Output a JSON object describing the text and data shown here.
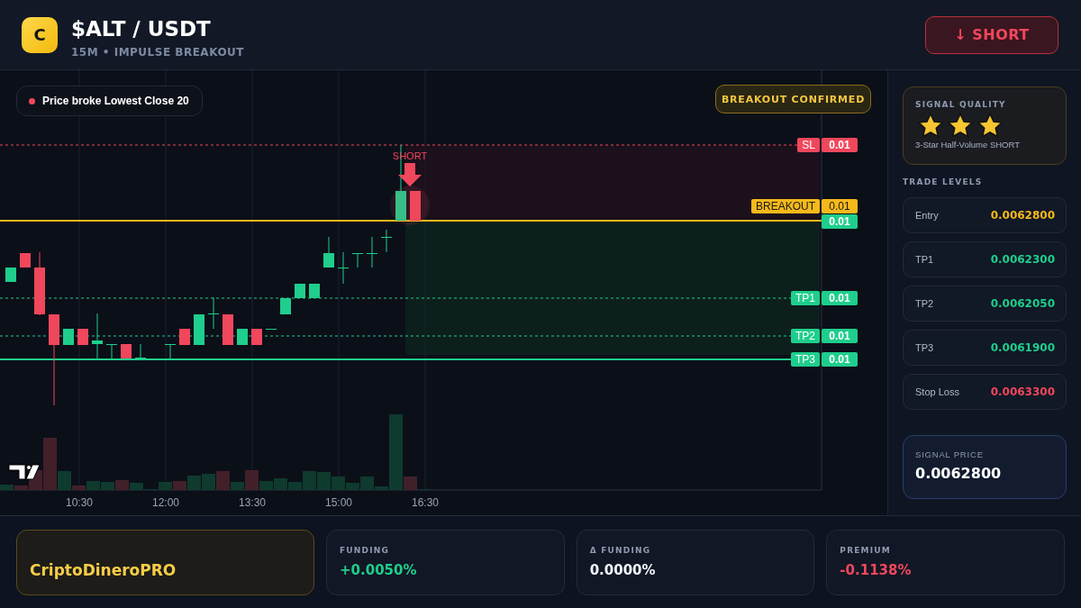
{
  "header": {
    "logo": "C",
    "pair": "$ALT / USDT",
    "subtitle": "15M • IMPULSE BREAKOUT",
    "action": {
      "label": "↓ SHORT",
      "kind": "short"
    }
  },
  "chart": {
    "condition": "Price broke Lowest Close 20",
    "status_badge": "BREAKOUT CONFIRMED",
    "signal_marker": "SHORT",
    "levels": [
      {
        "kind": "sl",
        "label": "SL",
        "value": "0.01"
      },
      {
        "kind": "breakout",
        "label": "BREAKOUT",
        "value": "0.01"
      },
      {
        "kind": "entry",
        "value": "0.01"
      },
      {
        "kind": "tp",
        "label": "TP1",
        "value": "0.01"
      },
      {
        "kind": "tp",
        "label": "TP2",
        "value": "0.01"
      },
      {
        "kind": "tp_final",
        "label": "TP3",
        "value": "0.01"
      }
    ],
    "time_labels": [
      "10:30",
      "12:00",
      "13:30",
      "15:00",
      "16:30"
    ]
  },
  "signal_quality": {
    "title": "SIGNAL QUALITY",
    "stars": 3,
    "caption": "3-Star Half-Volume SHORT"
  },
  "trade_levels": {
    "title": "TRADE LEVELS",
    "rows": [
      {
        "kind": "entry",
        "label": "Entry",
        "value": "0.0062800"
      },
      {
        "kind": "tp",
        "label": "TP1",
        "value": "0.0062300"
      },
      {
        "kind": "tp",
        "label": "TP2",
        "value": "0.0062050"
      },
      {
        "kind": "tp",
        "label": "TP3",
        "value": "0.0061900"
      },
      {
        "kind": "sl",
        "label": "Stop Loss",
        "value": "0.0063300"
      }
    ]
  },
  "signal_price": {
    "label": "SIGNAL PRICE",
    "value": "0.0062800"
  },
  "footer": {
    "brand": "CriptoDineroPRO",
    "metrics": [
      {
        "kind": "positive",
        "label": "FUNDING",
        "value": "+0.0050%"
      },
      {
        "kind": "neutral",
        "label": "Δ FUNDING",
        "value": "0.0000%"
      },
      {
        "kind": "negative",
        "label": "PREMIUM",
        "value": "-0.1138%"
      }
    ]
  }
}
